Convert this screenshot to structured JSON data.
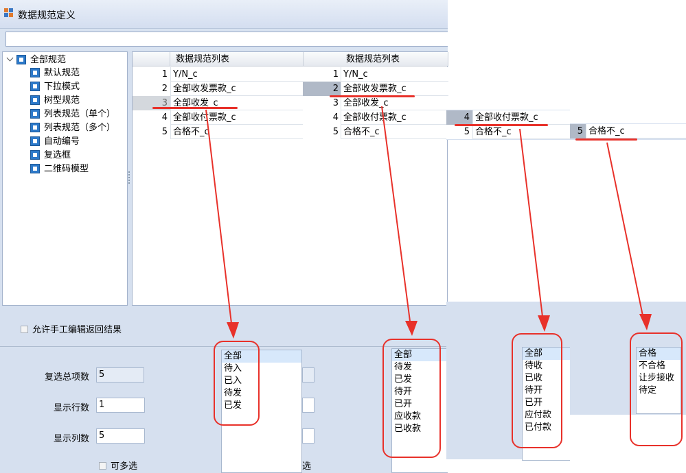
{
  "window": {
    "title": "数据规范定义",
    "search_value": ""
  },
  "tree": {
    "root": "全部规范",
    "children": [
      "默认规范",
      "下拉模式",
      "树型规范",
      "列表规范（单个）",
      "列表规范（多个）",
      "自动编号",
      "复选框",
      "二维码模型"
    ]
  },
  "grid": {
    "header": "数据规范列表",
    "rows": [
      {
        "num": "1",
        "name": "Y/N_c"
      },
      {
        "num": "2",
        "name": "全部收发票款_c"
      },
      {
        "num": "3",
        "name": "全部收发_c"
      },
      {
        "num": "4",
        "name": "全部收付票款_c"
      },
      {
        "num": "5",
        "name": "合格不_c"
      }
    ]
  },
  "form": {
    "allow_edit_label": "允许手工编辑返回结果",
    "total_items_label": "复选总项数",
    "total_items_value": "5",
    "rows_label": "显示行数",
    "rows_value": "1",
    "cols_label": "显示列数",
    "cols_value": "5",
    "multi_label": "可多选",
    "multi_fragment": "选"
  },
  "lists": {
    "list1": [
      "全部",
      "待入",
      "已入",
      "待发",
      "已发"
    ],
    "list2": [
      "全部",
      "待发",
      "已发",
      "待开",
      "已开",
      "应收款",
      "已收款"
    ],
    "list3": [
      "全部",
      "待收",
      "已收",
      "待开",
      "已开",
      "应付款",
      "已付款"
    ],
    "list4": [
      "合格",
      "不合格",
      "让步接收",
      "待定"
    ]
  },
  "colors": {
    "accent_red": "#e8312a",
    "selection": "#d7e8fb",
    "panel": "#d6e0ef"
  }
}
